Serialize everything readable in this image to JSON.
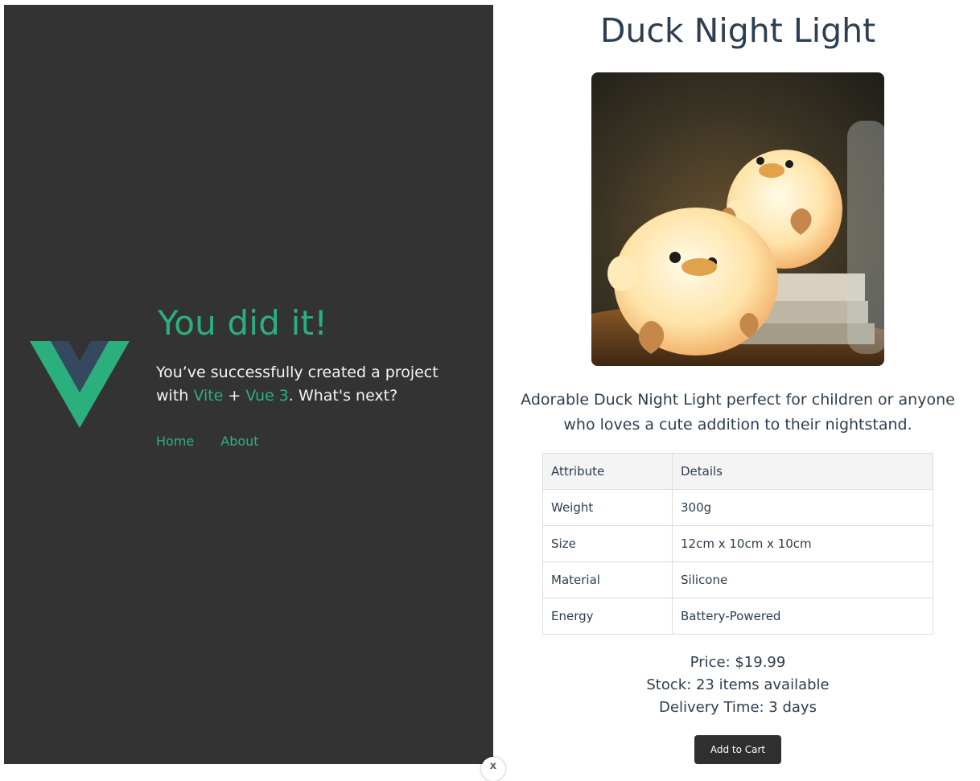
{
  "colors": {
    "panel_bg": "#333333",
    "vue_green": "#2bb07d",
    "vue_dark": "#35495e",
    "text": "#2c3e50",
    "button_bg": "#2f2f2f"
  },
  "hero": {
    "logo": "vue-logo",
    "title": "You did it!",
    "sub_prefix": "You’ve successfully created a project with",
    "link_vite": "Vite",
    "plus": "+",
    "link_vue": "Vue 3",
    "sub_suffix": ". What's next?"
  },
  "nav": {
    "home": "Home",
    "about": "About"
  },
  "product": {
    "title": "Duck Night Light",
    "image_icon": "duck-night-light-photo",
    "description": "Adorable Duck Night Light perfect for children or anyone who loves a cute addition to their nightstand.",
    "table": {
      "header": {
        "attribute": "Attribute",
        "details": "Details"
      },
      "rows": [
        {
          "attribute": "Weight",
          "details": "300g"
        },
        {
          "attribute": "Size",
          "details": "12cm x 10cm x 10cm"
        },
        {
          "attribute": "Material",
          "details": "Silicone"
        },
        {
          "attribute": "Energy",
          "details": "Battery-Powered"
        }
      ]
    },
    "price": "Price: $19.99",
    "stock": "Stock: 23 items available",
    "delivery": "Delivery Time: 3 days",
    "add_to_cart": "Add to Cart"
  },
  "close_badge": {
    "icon": "close-icon",
    "glyph": "x"
  }
}
